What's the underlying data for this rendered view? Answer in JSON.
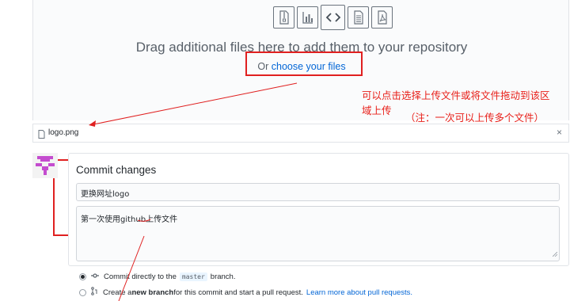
{
  "upload": {
    "file_types": [
      "zip-file-icon",
      "chart-file-icon",
      "code-file-icon",
      "text-file-icon",
      "pdf-file-icon"
    ],
    "drag_text": "Drag additional files here to add them to your repository",
    "or_text": "Or ",
    "choose_link": "choose your files"
  },
  "annotations": {
    "note_line1": "可以点击选择上传文件或将文件拖动到该区",
    "note_line2": "域上传",
    "note_line3": "（注：一次可以上传多个文件）",
    "color": "#e8201a"
  },
  "file_list": [
    {
      "name": "logo.png",
      "remove": "×"
    }
  ],
  "commit": {
    "title": "Commit changes",
    "summary_value": "更换网址logo",
    "description_value": "第一次使用github上传文件",
    "option1_prefix": "Commit directly to the ",
    "option1_branch": "master",
    "option1_suffix": " branch.",
    "option2_prefix": "Create a ",
    "option2_bold": "new branch",
    "option2_suffix": " for this commit and start a pull request.",
    "option2_link": "Learn more about pull requests."
  },
  "colors": {
    "link": "#0366d6",
    "annotation": "#e02020",
    "avatar": "#c44ccf"
  }
}
